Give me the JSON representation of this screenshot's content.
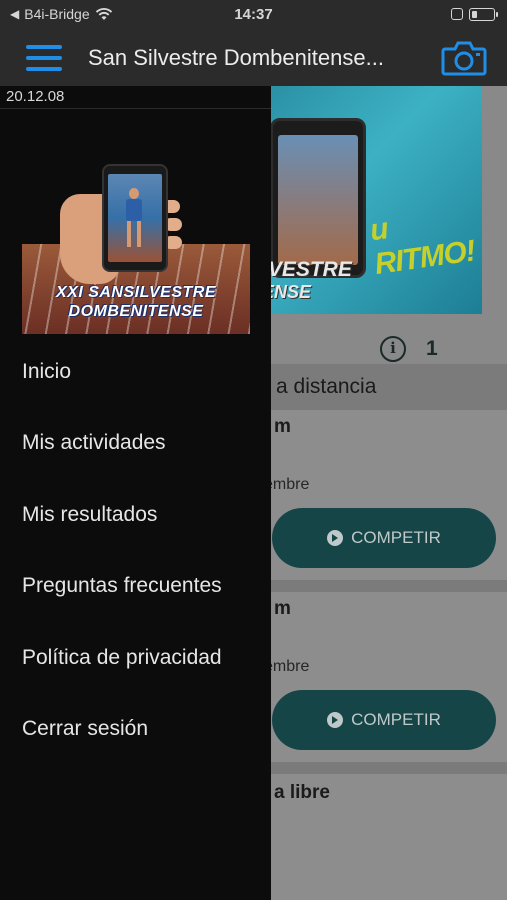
{
  "status_bar": {
    "back_label": "B4i-Bridge",
    "time": "14:37",
    "battery_level": 0.25
  },
  "app_bar": {
    "title": "San Silvestre Dombenitense...",
    "menu_icon": "hamburger-icon",
    "camera_icon": "camera-icon",
    "accent_color": "#1f8ee8"
  },
  "drawer": {
    "version": "20.12.08",
    "banner": {
      "title_line1": "XXI SANSILVESTRE",
      "title_line2": "DOMBENITENSE"
    },
    "items": [
      {
        "label": "Inicio"
      },
      {
        "label": "Mis actividades"
      },
      {
        "label": "Mis resultados"
      },
      {
        "label": "Preguntas frecuentes"
      },
      {
        "label": "Política de privacidad"
      },
      {
        "label": "Cerrar sesión"
      }
    ]
  },
  "background": {
    "banner": {
      "slogan": "u RITMO!",
      "title_line1": "IVESTRE",
      "title_line2": "ENSE"
    },
    "info_icon": "info-icon",
    "info_count": "1",
    "section_distance": "a distancia",
    "cards": [
      {
        "distance": "m",
        "date": "embre",
        "button_label": "COMPETIR"
      },
      {
        "distance": "m",
        "date": "embre",
        "button_label": "COMPETIR"
      }
    ],
    "section_free": "a libre"
  }
}
